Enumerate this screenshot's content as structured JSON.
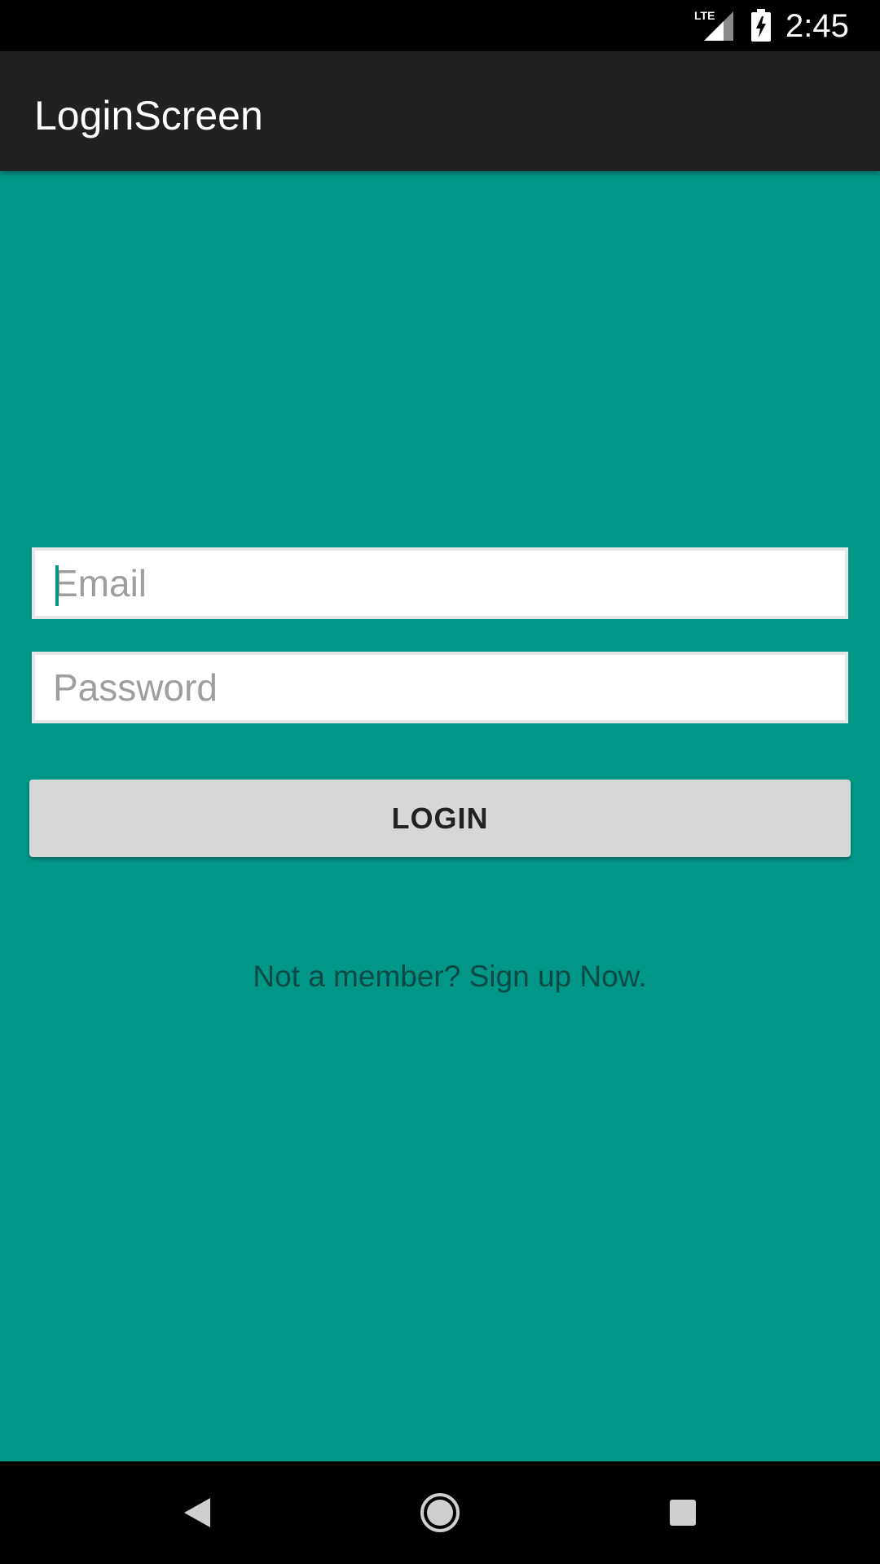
{
  "status_bar": {
    "network_label": "LTE",
    "time": "2:45"
  },
  "app_bar": {
    "title": "LoginScreen"
  },
  "form": {
    "email_placeholder": "Email",
    "email_value": "",
    "password_placeholder": "Password",
    "password_value": "",
    "login_label": "LOGIN",
    "signup_text": "Not a member? Sign up Now."
  },
  "nav_bar": {
    "icons": [
      "back-icon",
      "home-icon",
      "recents-icon"
    ]
  },
  "colors": {
    "background": "#009688",
    "app_bar": "#212121",
    "button": "#d6d7d7",
    "link_text": "#0b4a44"
  }
}
